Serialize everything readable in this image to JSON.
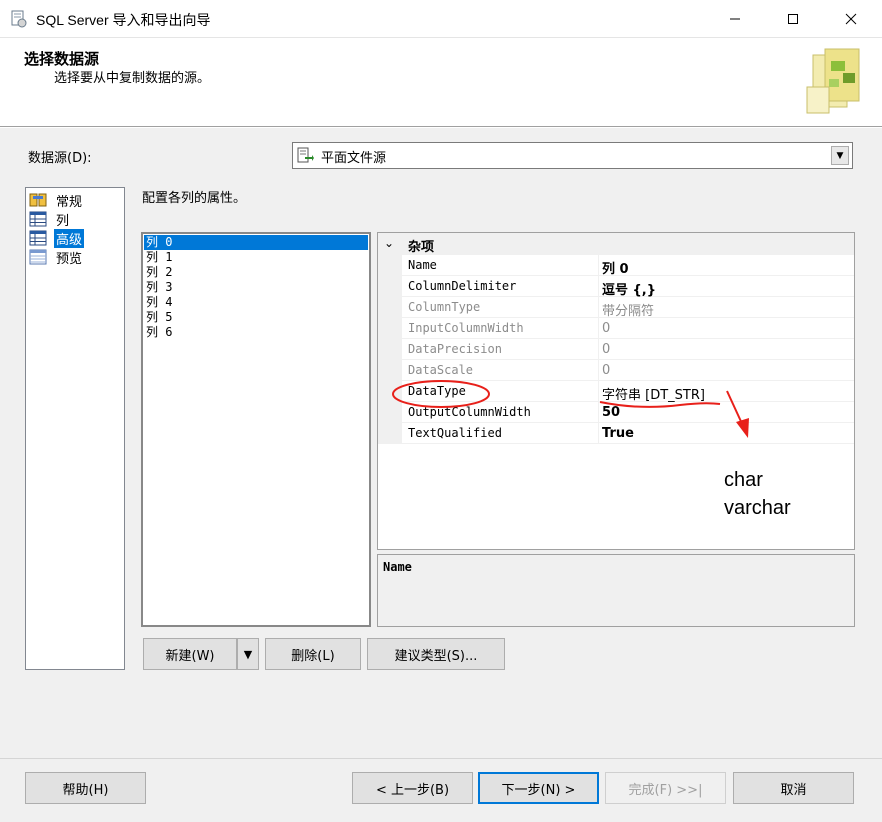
{
  "window": {
    "title": "SQL Server 导入和导出向导"
  },
  "header": {
    "title": "选择数据源",
    "subtitle": "选择要从中复制数据的源。"
  },
  "data_source": {
    "label": "数据源(D):",
    "value": "平面文件源"
  },
  "nav": {
    "items": [
      {
        "label": "常规",
        "icon": "general-icon",
        "selected": false
      },
      {
        "label": "列",
        "icon": "columns-icon",
        "selected": false
      },
      {
        "label": "高级",
        "icon": "advanced-icon",
        "selected": true
      },
      {
        "label": "预览",
        "icon": "preview-icon",
        "selected": false
      }
    ]
  },
  "section_label": "配置各列的属性。",
  "columns": [
    "列 0",
    "列 1",
    "列 2",
    "列 3",
    "列 4",
    "列 5",
    "列 6"
  ],
  "selected_column": "列 0",
  "properties": {
    "category": "杂项",
    "rows": [
      {
        "name": "Name",
        "value": "列 0",
        "bold": true,
        "disabled": false
      },
      {
        "name": "ColumnDelimiter",
        "value": "逗号 {,}",
        "bold": true,
        "disabled": false
      },
      {
        "name": "ColumnType",
        "value": "带分隔符",
        "bold": false,
        "disabled": true
      },
      {
        "name": "InputColumnWidth",
        "value": "0",
        "bold": false,
        "disabled": true
      },
      {
        "name": "DataPrecision",
        "value": "0",
        "bold": false,
        "disabled": true
      },
      {
        "name": "DataScale",
        "value": "0",
        "bold": false,
        "disabled": true
      },
      {
        "name": "DataType",
        "value": "字符串 [DT_STR]",
        "bold": false,
        "disabled": false
      },
      {
        "name": "OutputColumnWidth",
        "value": "50",
        "bold": true,
        "disabled": false
      },
      {
        "name": "TextQualified",
        "value": "True",
        "bold": true,
        "disabled": false
      }
    ]
  },
  "description": {
    "title": "Name"
  },
  "column_buttons": {
    "new": "新建(W)",
    "delete": "删除(L)",
    "suggest": "建议类型(S)..."
  },
  "footer_buttons": {
    "help": "帮助(H)",
    "back": "< 上一步(B)",
    "next": "下一步(N) >",
    "finish": "完成(F) >>|",
    "cancel": "取消"
  },
  "annotation": {
    "line1": "char",
    "line2": "varchar",
    "color": "#e8201a"
  },
  "colors": {
    "selection": "#0078d7",
    "dialog_bg": "#f0f0f0"
  }
}
